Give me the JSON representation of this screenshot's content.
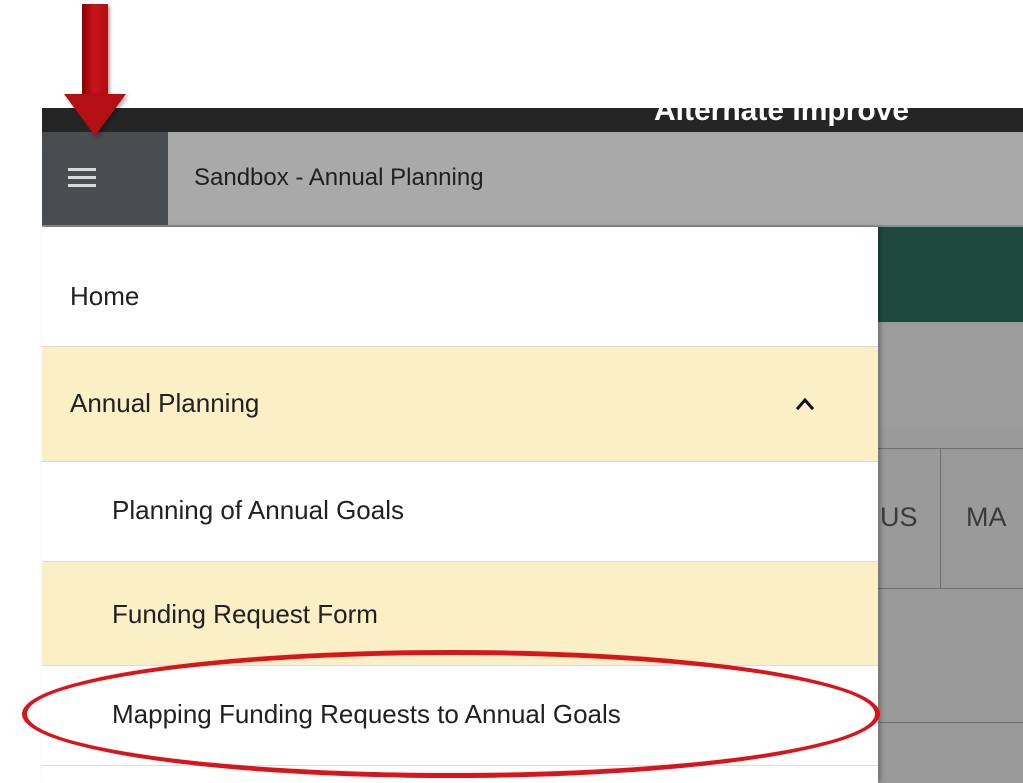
{
  "window": {
    "top_title_partial": "Alternate Improve",
    "header_title": "Sandbox - Annual Planning"
  },
  "menu": {
    "items": [
      {
        "label": "Home"
      },
      {
        "label": "Annual Planning",
        "expanded": true
      },
      {
        "label": "Planning of Annual Goals"
      },
      {
        "label": "Funding Request Form",
        "highlighted": true
      },
      {
        "label": "Mapping Funding Requests to Annual Goals"
      }
    ]
  },
  "background": {
    "col_text_1": "US",
    "col_text_2": "MA"
  },
  "icons": {
    "menu": "hamburger-icon",
    "expand": "chevron-up-icon"
  },
  "colors": {
    "highlight": "#fbefc6",
    "header_gray": "#a9a9a9",
    "hamburger_bg": "#4a4d50",
    "teal": "#1e4a3e",
    "annotation_red": "#d9141b"
  }
}
